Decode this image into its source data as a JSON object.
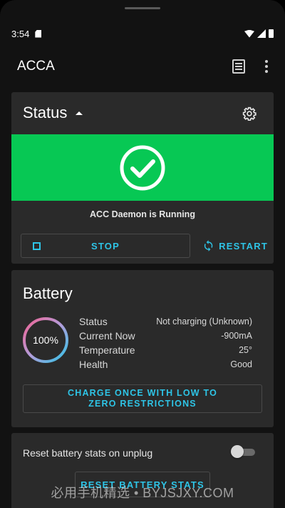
{
  "statusbar": {
    "time": "3:54"
  },
  "appbar": {
    "title": "ACCA"
  },
  "status_card": {
    "title": "Status",
    "daemon_status": "ACC Daemon is Running",
    "stop_label": "STOP",
    "restart_label": "RESTART",
    "banner_color": "#07c854"
  },
  "battery_card": {
    "title": "Battery",
    "level": "100%",
    "stats": [
      {
        "label": "Status",
        "value": "Not charging (Unknown)"
      },
      {
        "label": "Current Now",
        "value": "-900mA"
      },
      {
        "label": "Temperature",
        "value": "25°"
      },
      {
        "label": "Health",
        "value": "Good"
      }
    ],
    "charge_once_label": "CHARGE ONCE WITH LOW TO ZERO RESTRICTIONS"
  },
  "reset_card": {
    "label": "Reset battery stats on unplug",
    "toggle_on": false,
    "button_label": "RESET BATTERY STATS"
  },
  "watermark": "必用手机精选 • BYJSJXY.COM",
  "colors": {
    "accent": "#2ec4e6",
    "card": "#2a2a2a",
    "background": "#121212"
  }
}
